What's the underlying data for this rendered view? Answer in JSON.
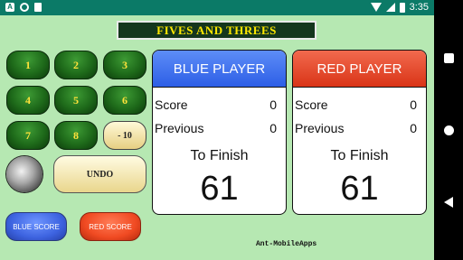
{
  "status_bar": {
    "icons": [
      "a-icon",
      "record-icon",
      "sim-icon"
    ],
    "a_label": "A",
    "time": "3:35"
  },
  "app": {
    "title": "FIVES AND THREES"
  },
  "keypad": {
    "buttons": [
      "1",
      "2",
      "3",
      "4",
      "5",
      "6",
      "7",
      "8"
    ],
    "minus_label": "- 10",
    "undo_label": "UNDO",
    "blue_score_label": "BLUE SCORE",
    "red_score_label": "RED SCORE"
  },
  "blue_panel": {
    "title": "BLUE PLAYER",
    "score_label": "Score",
    "score_value": "0",
    "previous_label": "Previous",
    "previous_value": "0",
    "finish_label": "To Finish",
    "finish_value": "61",
    "color": "#3d6af0"
  },
  "red_panel": {
    "title": "RED PLAYER",
    "score_label": "Score",
    "score_value": "0",
    "previous_label": "Previous",
    "previous_value": "0",
    "finish_label": "To Finish",
    "finish_value": "61",
    "color": "#e5411f"
  },
  "brand": "Ant-MobileApps",
  "colors": {
    "background": "#b6e8b2",
    "status_bar": "#0b7a67",
    "title_text": "#ffe800",
    "keypad_button": "#1e6a1a"
  }
}
